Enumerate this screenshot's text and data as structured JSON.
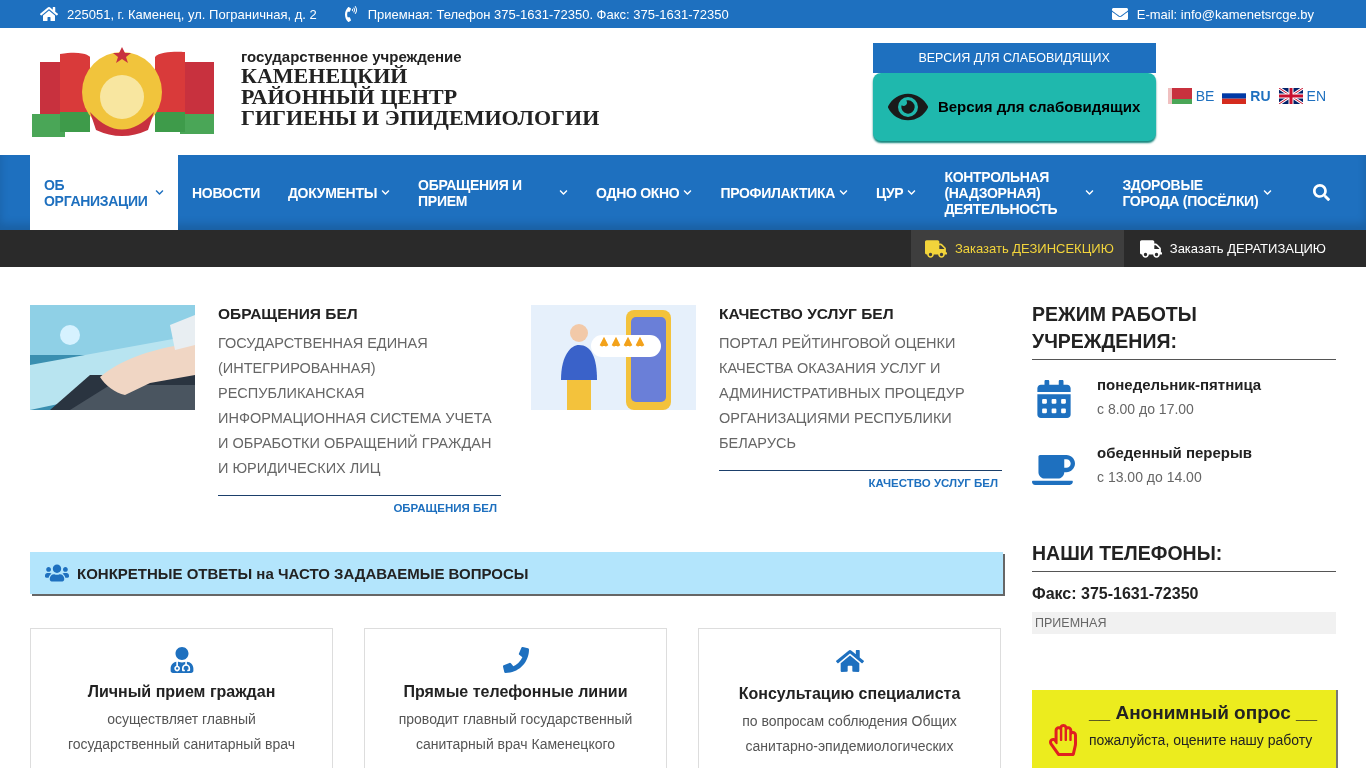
{
  "top_bar": {
    "address": "225051, г. Каменец, ул. Пограничная, д. 2",
    "phone": "Приемная: Телефон 375-1631-72350. Факс: 375-1631-72350",
    "email": "E-mail: info@kamenetsrcge.by"
  },
  "header": {
    "org_type": "государственное учреждение",
    "org_name": [
      "КАМЕНЕЦКИЙ",
      "РАЙОННЫЙ ЦЕНТР",
      "ГИГИЕНЫ И ЭПИДЕМИОЛОГИИ"
    ],
    "accessibility_banner": "ВЕРСИЯ ДЛЯ СЛАБОВИДЯЩИХ",
    "accessibility_button": "Версия для слабовидящих",
    "languages": [
      {
        "code": "BE",
        "kind": "by",
        "selected": false
      },
      {
        "code": "RU",
        "kind": "ru",
        "selected": true
      },
      {
        "code": "EN",
        "kind": "gb",
        "selected": false
      }
    ]
  },
  "nav": {
    "items": [
      {
        "label": "ОБ ОРГАНИЗАЦИИ",
        "selected": true,
        "dropdown": true
      },
      {
        "label": "НОВОСТИ",
        "selected": false,
        "dropdown": false
      },
      {
        "label": "ДОКУМЕНТЫ",
        "selected": false,
        "dropdown": true
      },
      {
        "label": "ОБРАЩЕНИЯ И ПРИЕМ",
        "selected": false,
        "dropdown": true
      },
      {
        "label": "ОДНО ОКНО",
        "selected": false,
        "dropdown": true
      },
      {
        "label": "ПРОФИЛАКТИКА",
        "selected": false,
        "dropdown": true
      },
      {
        "label": "ЦУР",
        "selected": false,
        "dropdown": true
      },
      {
        "label": "КОНТРОЛЬНАЯ (НАДЗОРНАЯ) ДЕЯТЕЛЬНОСТЬ",
        "selected": false,
        "dropdown": true
      },
      {
        "label": "ЗДОРОВЫЕ ГОРОДА (ПОСЁЛКИ)",
        "selected": false,
        "dropdown": true
      }
    ]
  },
  "actions": [
    {
      "label": "Заказать ДЕЗИНСЕКЦИЮ",
      "selected": true
    },
    {
      "label": "Заказать ДЕРАТИЗАЦИЮ",
      "selected": false
    }
  ],
  "features": [
    {
      "kind": "laptop",
      "title": "ОБРАЩЕНИЯ БЕЛ",
      "text": "ГОСУДАРСТВЕННАЯ ЕДИНАЯ (ИНТЕГРИРОВАННАЯ) РЕСПУБЛИКАНСКАЯ ИНФОРМАЦИОННАЯ СИСТЕМА УЧЕТА И ОБРАБОТКИ ОБРАЩЕНИЙ ГРАЖДАН И ЮРИДИЧЕСКИХ ЛИЦ",
      "link": "ОБРАЩЕНИЯ БЕЛ"
    },
    {
      "kind": "rating",
      "title": "КАЧЕСТВО УСЛУГ БЕЛ",
      "text": "ПОРТАЛ РЕЙТИНГОВОЙ ОЦЕНКИ КАЧЕСТВА ОКАЗАНИЯ УСЛУГ И АДМИНИСТРАТИВНЫХ ПРОЦЕДУР ОРГАНИЗАЦИЯМИ РЕСПУБЛИКИ БЕЛАРУСЬ",
      "link": "КАЧЕСТВО УСЛУГ БЕЛ"
    }
  ],
  "faq": {
    "title": "КОНКРЕТНЫЕ ОТВЕТЫ на ЧАСТО ЗАДАВАЕМЫЕ ВОПРОСЫ",
    "cards": [
      {
        "kind": "doctor",
        "title": "Личный прием граждан",
        "text": "осуществляет главный государственный санитарный врач"
      },
      {
        "kind": "phone",
        "title": "Прямые телефонные линии",
        "text": "проводит главный государственный санитарный врач Каменецкого"
      },
      {
        "kind": "house",
        "title": "Консультацию специалиста",
        "text": "по вопросам соблюдения Общих санитарно-эпидемиологических"
      }
    ]
  },
  "sidebar": {
    "hours_title": "РЕЖИМ РАБОТЫ УЧРЕЖДЕНИЯ:",
    "hours": [
      {
        "kind": "calendar",
        "title": "понедельник-пятница",
        "time": "с 8.00 до 17.00"
      },
      {
        "kind": "cup",
        "title": "обеденный перерыв",
        "time": "с 13.00 до 14.00"
      }
    ],
    "phones_title": "НАШИ ТЕЛЕФОНЫ:",
    "fax": "Факс: 375-1631-72350",
    "fax_label": "ПРИЕМНАЯ",
    "survey": {
      "title": "__ Анонимный опрос __",
      "text": "пожалуйста, оцените нашу работу"
    }
  }
}
